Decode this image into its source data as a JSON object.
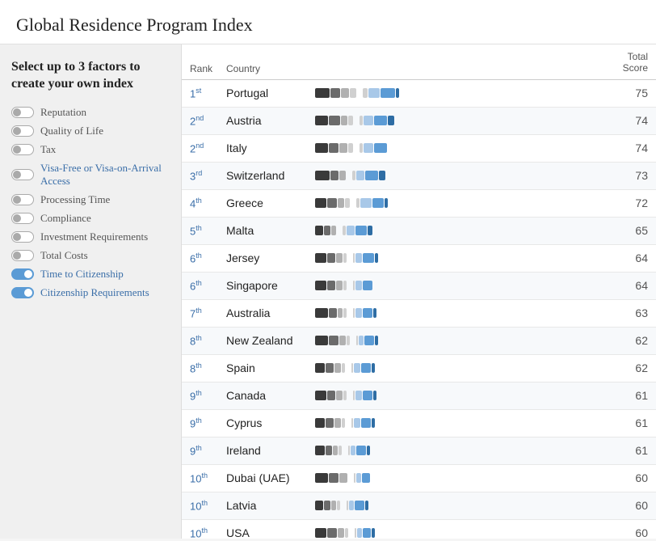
{
  "page": {
    "title": "Global Residence Program Index"
  },
  "sidebar": {
    "heading": "Select up to 3 factors to create your own index",
    "factors": [
      {
        "label": "Reputation",
        "active": false,
        "color": "dark"
      },
      {
        "label": "Quality of Life",
        "active": false,
        "color": "dark"
      },
      {
        "label": "Tax",
        "active": false,
        "color": "dark"
      },
      {
        "label": "Visa-Free or Visa-on-Arrival Access",
        "active": false,
        "color": "blue"
      },
      {
        "label": "Processing Time",
        "active": false,
        "color": "dark"
      },
      {
        "label": "Compliance",
        "active": false,
        "color": "dark"
      },
      {
        "label": "Investment Requirements",
        "active": false,
        "color": "dark"
      },
      {
        "label": "Total Costs",
        "active": false,
        "color": "dark"
      },
      {
        "label": "Time to Citizenship",
        "active": true,
        "color": "blue"
      },
      {
        "label": "Citizenship Requirements",
        "active": true,
        "color": "blue"
      }
    ]
  },
  "table": {
    "headers": {
      "rank": "Rank",
      "country": "Country",
      "score": "Total Score"
    },
    "rows": [
      {
        "rank": "1",
        "rank_sup": "st",
        "country": "Portugal",
        "score": 75,
        "bars": [
          [
            18,
            12,
            10,
            8
          ],
          [
            6,
            14,
            18,
            4
          ]
        ]
      },
      {
        "rank": "2",
        "rank_sup": "nd",
        "country": "Austria",
        "score": 74,
        "bars": [
          [
            16,
            14,
            8,
            6
          ],
          [
            4,
            12,
            16,
            8
          ]
        ]
      },
      {
        "rank": "2",
        "rank_sup": "nd",
        "country": "Italy",
        "score": 74,
        "bars": [
          [
            16,
            12,
            10,
            6
          ],
          [
            4,
            12,
            16,
            0
          ]
        ]
      },
      {
        "rank": "3",
        "rank_sup": "rd",
        "country": "Switzerland",
        "score": 73,
        "bars": [
          [
            18,
            10,
            8,
            0
          ],
          [
            4,
            10,
            16,
            8
          ]
        ]
      },
      {
        "rank": "4",
        "rank_sup": "th",
        "country": "Greece",
        "score": 72,
        "bars": [
          [
            14,
            12,
            8,
            6
          ],
          [
            4,
            14,
            14,
            4
          ]
        ]
      },
      {
        "rank": "5",
        "rank_sup": "th",
        "country": "Malta",
        "score": 65,
        "bars": [
          [
            10,
            8,
            6,
            0
          ],
          [
            4,
            10,
            14,
            6
          ]
        ]
      },
      {
        "rank": "6",
        "rank_sup": "th",
        "country": "Jersey",
        "score": 64,
        "bars": [
          [
            14,
            10,
            8,
            4
          ],
          [
            2,
            8,
            14,
            4
          ]
        ]
      },
      {
        "rank": "6",
        "rank_sup": "th",
        "country": "Singapore",
        "score": 64,
        "bars": [
          [
            14,
            10,
            8,
            4
          ],
          [
            2,
            8,
            12,
            0
          ]
        ]
      },
      {
        "rank": "7",
        "rank_sup": "th",
        "country": "Australia",
        "score": 63,
        "bars": [
          [
            16,
            10,
            6,
            4
          ],
          [
            2,
            8,
            12,
            4
          ]
        ]
      },
      {
        "rank": "8",
        "rank_sup": "th",
        "country": "New Zealand",
        "score": 62,
        "bars": [
          [
            16,
            12,
            8,
            4
          ],
          [
            2,
            6,
            12,
            4
          ]
        ]
      },
      {
        "rank": "8",
        "rank_sup": "th",
        "country": "Spain",
        "score": 62,
        "bars": [
          [
            12,
            10,
            8,
            4
          ],
          [
            2,
            8,
            12,
            4
          ]
        ]
      },
      {
        "rank": "9",
        "rank_sup": "th",
        "country": "Canada",
        "score": 61,
        "bars": [
          [
            14,
            10,
            8,
            4
          ],
          [
            2,
            8,
            12,
            4
          ]
        ]
      },
      {
        "rank": "9",
        "rank_sup": "th",
        "country": "Cyprus",
        "score": 61,
        "bars": [
          [
            12,
            10,
            8,
            4
          ],
          [
            2,
            8,
            12,
            4
          ]
        ]
      },
      {
        "rank": "9",
        "rank_sup": "th",
        "country": "Ireland",
        "score": 61,
        "bars": [
          [
            12,
            8,
            6,
            4
          ],
          [
            2,
            6,
            12,
            4
          ]
        ]
      },
      {
        "rank": "10",
        "rank_sup": "th",
        "country": "Dubai (UAE)",
        "score": 60,
        "bars": [
          [
            16,
            12,
            10,
            0
          ],
          [
            2,
            6,
            10,
            0
          ]
        ]
      },
      {
        "rank": "10",
        "rank_sup": "th",
        "country": "Latvia",
        "score": 60,
        "bars": [
          [
            10,
            8,
            6,
            4
          ],
          [
            2,
            6,
            12,
            4
          ]
        ]
      },
      {
        "rank": "10",
        "rank_sup": "th",
        "country": "USA",
        "score": 60,
        "bars": [
          [
            14,
            12,
            8,
            4
          ],
          [
            2,
            6,
            10,
            4
          ]
        ]
      }
    ]
  }
}
